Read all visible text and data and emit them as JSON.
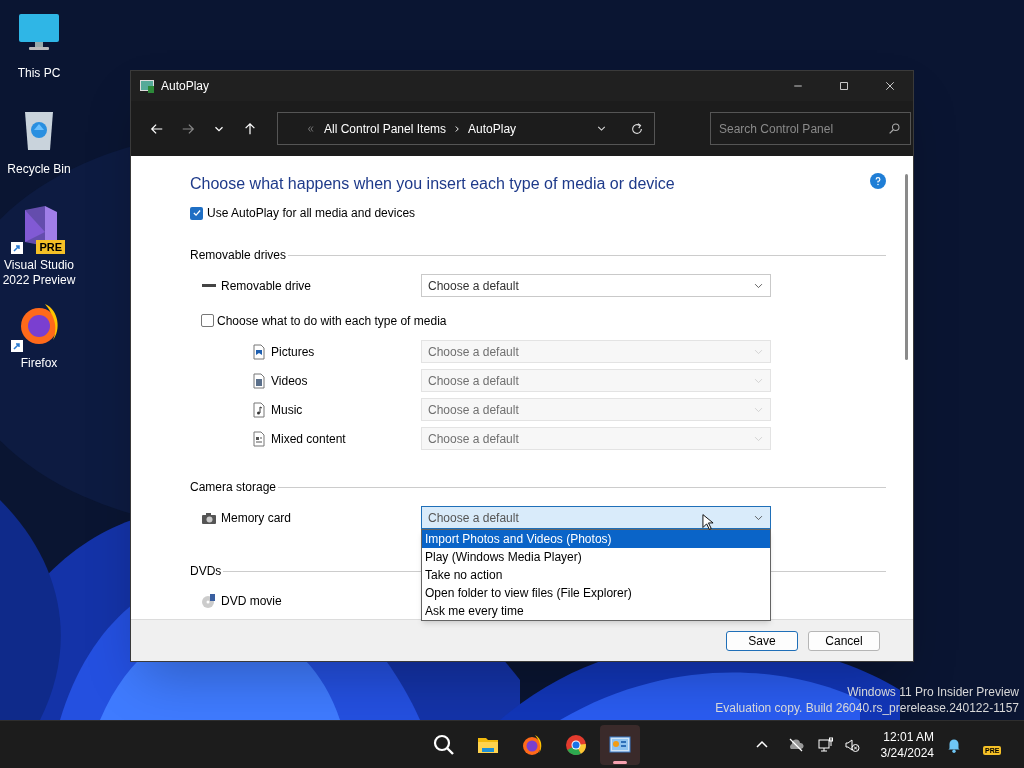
{
  "desktop_icons": [
    {
      "kind": "pc",
      "label": "This PC"
    },
    {
      "kind": "bin",
      "label": "Recycle Bin"
    },
    {
      "kind": "vs",
      "label": "Visual Studio 2022 Preview",
      "badge": "PRE"
    },
    {
      "kind": "firefox",
      "label": "Firefox"
    }
  ],
  "window": {
    "title": "AutoPlay",
    "address": {
      "breadcrumb": [
        "All Control Panel Items",
        "AutoPlay"
      ]
    },
    "search": {
      "placeholder": "Search Control Panel"
    },
    "heading": "Choose what happens when you insert each type of media or device",
    "use_autoplay": {
      "label": "Use AutoPlay for all media and devices",
      "checked": true
    },
    "sections": [
      {
        "title": "Removable drives",
        "rows": [
          {
            "kind": "drive",
            "label": "Removable drive",
            "select": {
              "value": "Choose a default",
              "disabled": false,
              "expanded": false
            }
          },
          {
            "kind": "checkbox",
            "label": "Choose what to do with each type of media",
            "checked": false
          },
          {
            "kind": "pictures",
            "label": "Pictures",
            "select": {
              "value": "Choose a default",
              "disabled": true,
              "expanded": false
            }
          },
          {
            "kind": "videos",
            "label": "Videos",
            "select": {
              "value": "Choose a default",
              "disabled": true,
              "expanded": false
            }
          },
          {
            "kind": "music",
            "label": "Music",
            "select": {
              "value": "Choose a default",
              "disabled": true,
              "expanded": false
            }
          },
          {
            "kind": "mixed",
            "label": "Mixed content",
            "select": {
              "value": "Choose a default",
              "disabled": true,
              "expanded": false
            }
          }
        ]
      },
      {
        "title": "Camera storage",
        "rows": [
          {
            "kind": "camera",
            "label": "Memory card",
            "select": {
              "value": "Choose a default",
              "disabled": false,
              "expanded": true,
              "options": [
                {
                  "label": "Import Photos and Videos (Photos)",
                  "selected": true
                },
                {
                  "label": "Play (Windows Media Player)",
                  "selected": false
                },
                {
                  "label": "Take no action",
                  "selected": false
                },
                {
                  "label": "Open folder to view files (File Explorer)",
                  "selected": false
                },
                {
                  "label": "Ask me every time",
                  "selected": false
                }
              ]
            }
          }
        ]
      },
      {
        "title": "DVDs",
        "rows": [
          {
            "kind": "dvd",
            "label": "DVD movie"
          }
        ]
      }
    ],
    "buttons": [
      {
        "label": "Save",
        "default": true
      },
      {
        "label": "Cancel",
        "default": false
      }
    ]
  },
  "os_notice": [
    "Windows 11 Pro Insider Preview",
    "Evaluation copy. Build 26040.rs_prerelease.240122-1157"
  ],
  "taskbar": {
    "apps": [
      {
        "kind": "search",
        "active": false
      },
      {
        "kind": "explorer",
        "active": false
      },
      {
        "kind": "firefox",
        "active": false
      },
      {
        "kind": "chrome",
        "active": false
      },
      {
        "kind": "control-panel",
        "active": true
      }
    ],
    "time": "12:01 AM",
    "date": "3/24/2024",
    "badge": "PRE"
  }
}
